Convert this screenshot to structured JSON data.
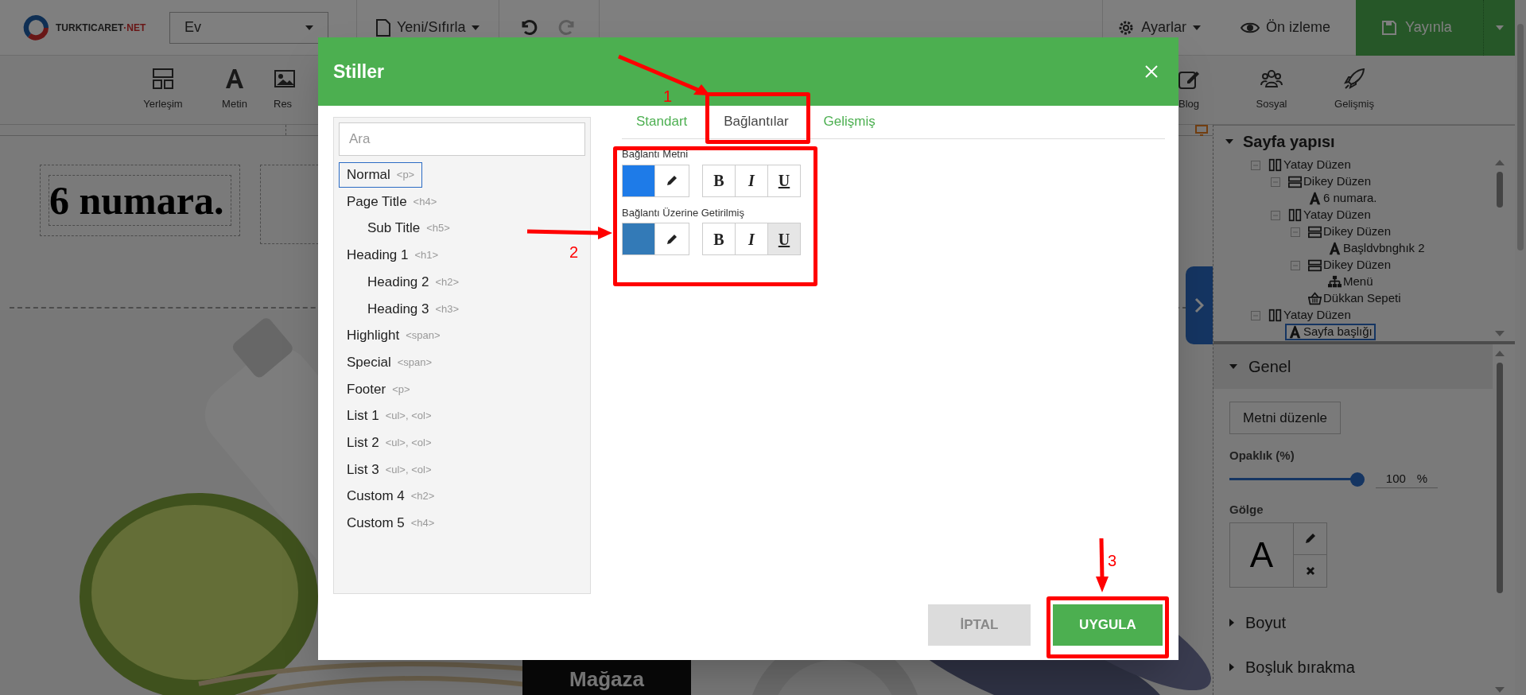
{
  "top_bar": {
    "logo_text": "TURKTICARET",
    "logo_suffix": "·NET",
    "page_select": "Ev",
    "new_reset": "Yeni/Sıfırla",
    "settings": "Ayarlar",
    "preview": "Ön izleme",
    "publish": "Yayınla"
  },
  "toolbar_left": [
    {
      "label": "Yerleşim"
    },
    {
      "label": "Metin"
    },
    {
      "label": "Res"
    }
  ],
  "toolbar_right": [
    {
      "label": "Blog"
    },
    {
      "label": "Sosyal"
    },
    {
      "label": "Gelişmiş"
    }
  ],
  "canvas": {
    "heading": "6 numara.",
    "store_label": "Mağaza"
  },
  "structure_panel": {
    "title": "Sayfa yapısı",
    "tree": [
      {
        "label": "Yatay Düzen",
        "kind": "horizontal",
        "selected": false,
        "children": [
          {
            "label": "Dikey Düzen",
            "kind": "vertical",
            "selected": false,
            "children": [
              {
                "label": "6 numara.",
                "kind": "text",
                "selected": false
              }
            ]
          },
          {
            "label": "Yatay Düzen",
            "kind": "horizontal",
            "selected": false,
            "children": [
              {
                "label": "Dikey Düzen",
                "kind": "vertical",
                "selected": false,
                "children": [
                  {
                    "label": "Başldvbnghık 2",
                    "kind": "text",
                    "selected": false
                  }
                ]
              },
              {
                "label": "Dikey Düzen",
                "kind": "vertical",
                "selected": false,
                "children": [
                  {
                    "label": "Menü",
                    "kind": "menu",
                    "selected": false
                  }
                ]
              },
              {
                "label": "Dükkan Sepeti",
                "kind": "basket",
                "selected": false
              }
            ]
          }
        ]
      },
      {
        "label": "Yatay Düzen",
        "kind": "horizontal",
        "selected": false,
        "children": [
          {
            "label": "Sayfa başlığı",
            "kind": "text",
            "selected": true
          }
        ]
      }
    ]
  },
  "properties": {
    "edit_button": "Metni düzenle",
    "opacity_label": "Opaklık (%)",
    "opacity": {
      "level": 1,
      "value": "100",
      "unit": "%"
    },
    "shadow_label": "Gölge",
    "shadow_preview": "A",
    "sections": [
      {
        "label": "Genel",
        "expanded": true
      },
      {
        "label": "Boyut",
        "expanded": false
      },
      {
        "label": "Boşluk bırakma",
        "expanded": false
      }
    ]
  },
  "dialog": {
    "title": "Stiller",
    "search": {
      "placeholder": "Ara"
    },
    "styles": [
      {
        "name": "Normal",
        "tag": "<p>",
        "selected": true
      },
      {
        "name": "Page Title",
        "tag": "<h4>",
        "selected": false,
        "children": [
          {
            "name": "Sub Title",
            "tag": "<h5>",
            "selected": false
          }
        ]
      },
      {
        "name": "Heading 1",
        "tag": "<h1>",
        "selected": false,
        "children": [
          {
            "name": "Heading 2",
            "tag": "<h2>",
            "selected": false
          },
          {
            "name": "Heading 3",
            "tag": "<h3>",
            "selected": false
          }
        ]
      },
      {
        "name": "Highlight",
        "tag": "<span>",
        "selected": false
      },
      {
        "name": "Special",
        "tag": "<span>",
        "selected": false
      },
      {
        "name": "Footer",
        "tag": "<p>",
        "selected": false
      },
      {
        "name": "List 1",
        "tag": "<ul>, <ol>",
        "selected": false
      },
      {
        "name": "List 2",
        "tag": "<ul>, <ol>",
        "selected": false
      },
      {
        "name": "List 3",
        "tag": "<ul>, <ol>",
        "selected": false
      },
      {
        "name": "Custom 4",
        "tag": "<h2>",
        "selected": false
      },
      {
        "name": "Custom 5",
        "tag": "<h4>",
        "selected": false
      }
    ],
    "tabs": [
      {
        "label": "Standart",
        "selected": false
      },
      {
        "label": "Bağlantılar",
        "selected": true
      },
      {
        "label": "Gelişmiş",
        "selected": false
      }
    ],
    "link_styles": [
      {
        "label": "Bağlantı Metni",
        "color": "#1e7be8",
        "format": [
          {
            "label": "B",
            "active": false
          },
          {
            "label": "I",
            "active": false
          },
          {
            "label": "U",
            "active": false
          }
        ]
      },
      {
        "label": "Bağlantı Üzerine Getirilmiş",
        "color": "#337ab7",
        "format": [
          {
            "label": "B",
            "active": false
          },
          {
            "label": "I",
            "active": false
          },
          {
            "label": "U",
            "active": true
          }
        ]
      }
    ],
    "cancel": "İPTAL",
    "apply": "UYGULA"
  },
  "annotations": [
    {
      "number": "1"
    },
    {
      "number": "2"
    },
    {
      "number": "3"
    }
  ]
}
